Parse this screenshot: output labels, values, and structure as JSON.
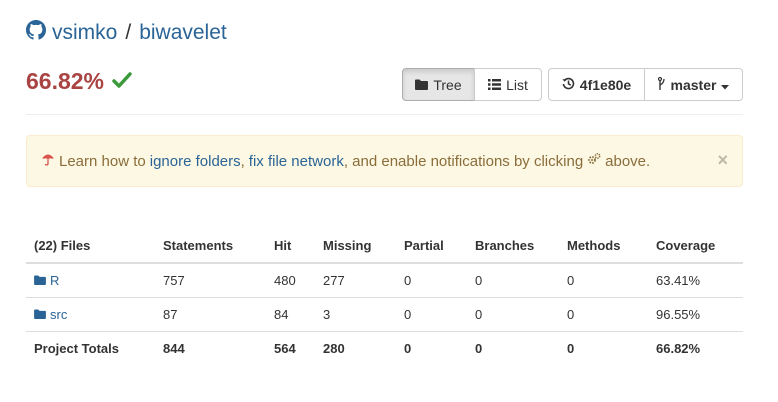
{
  "header": {
    "owner": "vsimko",
    "separator": "/",
    "repo": "biwavelet"
  },
  "coverage": {
    "percent": "66.82%",
    "status_icon": "check-icon",
    "color": "#a94442"
  },
  "view_toggle": {
    "tree_label": "Tree",
    "list_label": "List",
    "active": "Tree"
  },
  "commit": {
    "sha": "4f1e80e",
    "branch": "master"
  },
  "alert": {
    "prefix": "Learn how to",
    "link_ignore": "ignore folders",
    "comma": ",",
    "link_fix": "fix file network",
    "middle": ", and enable notifications by clicking",
    "suffix": "above.",
    "close": "×"
  },
  "table": {
    "headers": [
      "(22) Files",
      "Statements",
      "Hit",
      "Missing",
      "Partial",
      "Branches",
      "Methods",
      "Coverage"
    ],
    "rows": [
      {
        "name": "R",
        "statements": "757",
        "hit": "480",
        "missing": "277",
        "partial": "0",
        "branches": "0",
        "methods": "0",
        "coverage": "63.41%"
      },
      {
        "name": "src",
        "statements": "87",
        "hit": "84",
        "missing": "3",
        "partial": "0",
        "branches": "0",
        "methods": "0",
        "coverage": "96.55%"
      }
    ],
    "totals": {
      "name": "Project Totals",
      "statements": "844",
      "hit": "564",
      "missing": "280",
      "partial": "0",
      "branches": "0",
      "methods": "0",
      "coverage": "66.82%"
    }
  },
  "colors": {
    "link": "#2a6496",
    "alert_bg": "#fcf8e3",
    "alert_text": "#8a6d3b",
    "success": "#3c9a3c"
  }
}
